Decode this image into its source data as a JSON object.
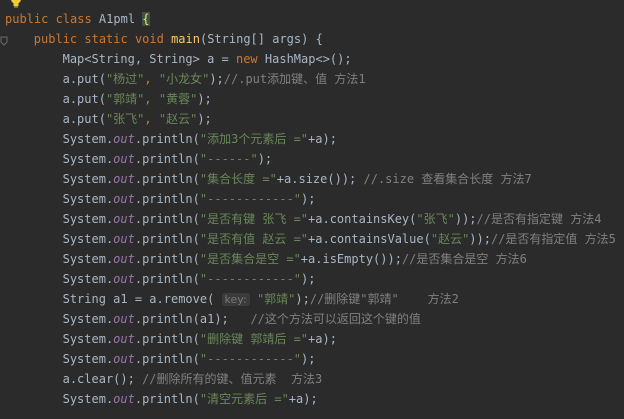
{
  "editor": {
    "language": "java",
    "colors": {
      "background": "#2b2b2b",
      "keyword": "#cc7832",
      "string": "#6a8759",
      "comment": "#808080",
      "field": "#9876aa",
      "method": "#ffc66d",
      "text": "#a9b7c6"
    },
    "icons": [
      "lightbulb-icon",
      "fold-marker-icon"
    ],
    "lines": [
      {
        "indent": 0,
        "tokens": [
          {
            "c": "kw",
            "t": "public class "
          },
          {
            "c": "plain",
            "t": "A1pml "
          },
          {
            "c": "brace-hl",
            "t": "{"
          }
        ]
      },
      {
        "indent": 4,
        "tokens": [
          {
            "c": "kw",
            "t": "public static void "
          },
          {
            "c": "fn",
            "t": "main"
          },
          {
            "c": "plain",
            "t": "(String[] args) {"
          }
        ]
      },
      {
        "indent": 8,
        "tokens": [
          {
            "c": "plain",
            "t": "Map<String, String> a = "
          },
          {
            "c": "kw",
            "t": "new "
          },
          {
            "c": "plain",
            "t": "HashMap<>();"
          }
        ]
      },
      {
        "indent": 8,
        "tokens": [
          {
            "c": "plain",
            "t": "a.put("
          },
          {
            "c": "str",
            "t": "\"杨过\""
          },
          {
            "c": "kw",
            "t": ", "
          },
          {
            "c": "str",
            "t": "\"小龙女\""
          },
          {
            "c": "plain",
            "t": ");"
          },
          {
            "c": "cmt",
            "t": "//.put添加键、值 方法1"
          }
        ]
      },
      {
        "indent": 8,
        "tokens": [
          {
            "c": "plain",
            "t": "a.put("
          },
          {
            "c": "str",
            "t": "\"郭靖\""
          },
          {
            "c": "kw",
            "t": ", "
          },
          {
            "c": "str",
            "t": "\"黄蓉\""
          },
          {
            "c": "plain",
            "t": ");"
          }
        ]
      },
      {
        "indent": 8,
        "tokens": [
          {
            "c": "plain",
            "t": "a.put("
          },
          {
            "c": "str",
            "t": "\"张飞\""
          },
          {
            "c": "kw",
            "t": ", "
          },
          {
            "c": "str",
            "t": "\"赵云\""
          },
          {
            "c": "plain",
            "t": ");"
          }
        ]
      },
      {
        "indent": 8,
        "tokens": [
          {
            "c": "plain",
            "t": "System."
          },
          {
            "c": "fld",
            "t": "out"
          },
          {
            "c": "plain",
            "t": ".println("
          },
          {
            "c": "str",
            "t": "\"添加3个元素后 =\""
          },
          {
            "c": "plain",
            "t": "+a);"
          }
        ]
      },
      {
        "indent": 8,
        "tokens": [
          {
            "c": "plain",
            "t": "System."
          },
          {
            "c": "fld",
            "t": "out"
          },
          {
            "c": "plain",
            "t": ".println("
          },
          {
            "c": "str",
            "t": "\"------\""
          },
          {
            "c": "plain",
            "t": ");"
          }
        ]
      },
      {
        "indent": 8,
        "tokens": [
          {
            "c": "plain",
            "t": "System."
          },
          {
            "c": "fld",
            "t": "out"
          },
          {
            "c": "plain",
            "t": ".println("
          },
          {
            "c": "str",
            "t": "\"集合长度 =\""
          },
          {
            "c": "plain",
            "t": "+a.size()); "
          },
          {
            "c": "cmt",
            "t": "//.size 查看集合长度 方法7"
          }
        ]
      },
      {
        "indent": 8,
        "tokens": [
          {
            "c": "plain",
            "t": "System."
          },
          {
            "c": "fld",
            "t": "out"
          },
          {
            "c": "plain",
            "t": ".println("
          },
          {
            "c": "str",
            "t": "\"------------\""
          },
          {
            "c": "plain",
            "t": ");"
          }
        ]
      },
      {
        "indent": 8,
        "tokens": [
          {
            "c": "plain",
            "t": "System."
          },
          {
            "c": "fld",
            "t": "out"
          },
          {
            "c": "plain",
            "t": ".println("
          },
          {
            "c": "str",
            "t": "\"是否有键 张飞 =\""
          },
          {
            "c": "plain",
            "t": "+a.containsKey("
          },
          {
            "c": "str",
            "t": "\"张飞\""
          },
          {
            "c": "plain",
            "t": "));"
          },
          {
            "c": "cmt",
            "t": "//是否有指定键 方法4"
          }
        ]
      },
      {
        "indent": 8,
        "tokens": [
          {
            "c": "plain",
            "t": "System."
          },
          {
            "c": "fld",
            "t": "out"
          },
          {
            "c": "plain",
            "t": ".println("
          },
          {
            "c": "str",
            "t": "\"是否有值 赵云 =\""
          },
          {
            "c": "plain",
            "t": "+a.containsValue("
          },
          {
            "c": "str",
            "t": "\"赵云\""
          },
          {
            "c": "plain",
            "t": "));"
          },
          {
            "c": "cmt",
            "t": "//是否有指定值 方法5"
          }
        ]
      },
      {
        "indent": 8,
        "tokens": [
          {
            "c": "plain",
            "t": "System."
          },
          {
            "c": "fld",
            "t": "out"
          },
          {
            "c": "plain",
            "t": ".println("
          },
          {
            "c": "str",
            "t": "\"是否集合是空 =\""
          },
          {
            "c": "plain",
            "t": "+a.isEmpty());"
          },
          {
            "c": "cmt",
            "t": "//是否集合是空 方法6"
          }
        ]
      },
      {
        "indent": 8,
        "tokens": [
          {
            "c": "plain",
            "t": "System."
          },
          {
            "c": "fld",
            "t": "out"
          },
          {
            "c": "plain",
            "t": ".println("
          },
          {
            "c": "str",
            "t": "\"------------\""
          },
          {
            "c": "plain",
            "t": ");"
          }
        ]
      },
      {
        "indent": 8,
        "tokens": [
          {
            "c": "plain",
            "t": "String a1 = a.remove( "
          },
          {
            "c": "hint",
            "t": "key:"
          },
          {
            "c": "str",
            "t": " \"郭靖\""
          },
          {
            "c": "plain",
            "t": ");"
          },
          {
            "c": "cmt",
            "t": "//删除键\"郭靖\"    方法2"
          }
        ]
      },
      {
        "indent": 8,
        "tokens": [
          {
            "c": "plain",
            "t": "System."
          },
          {
            "c": "fld",
            "t": "out"
          },
          {
            "c": "plain",
            "t": ".println(a1);   "
          },
          {
            "c": "cmt",
            "t": "//这个方法可以返回这个键的值"
          }
        ]
      },
      {
        "indent": 8,
        "tokens": [
          {
            "c": "plain",
            "t": "System."
          },
          {
            "c": "fld",
            "t": "out"
          },
          {
            "c": "plain",
            "t": ".println("
          },
          {
            "c": "str",
            "t": "\"删除键 郭靖后 =\""
          },
          {
            "c": "plain",
            "t": "+a);"
          }
        ]
      },
      {
        "indent": 8,
        "tokens": [
          {
            "c": "plain",
            "t": "System."
          },
          {
            "c": "fld",
            "t": "out"
          },
          {
            "c": "plain",
            "t": ".println("
          },
          {
            "c": "str",
            "t": "\"------------\""
          },
          {
            "c": "plain",
            "t": ");"
          }
        ]
      },
      {
        "indent": 8,
        "tokens": [
          {
            "c": "plain",
            "t": "a.clear(); "
          },
          {
            "c": "cmt",
            "t": "//删除所有的键、值元素  方法3"
          }
        ]
      },
      {
        "indent": 8,
        "tokens": [
          {
            "c": "plain",
            "t": "System."
          },
          {
            "c": "fld",
            "t": "out"
          },
          {
            "c": "plain",
            "t": ".println("
          },
          {
            "c": "str",
            "t": "\"清空元素后 =\""
          },
          {
            "c": "plain",
            "t": "+a);"
          }
        ]
      }
    ]
  }
}
